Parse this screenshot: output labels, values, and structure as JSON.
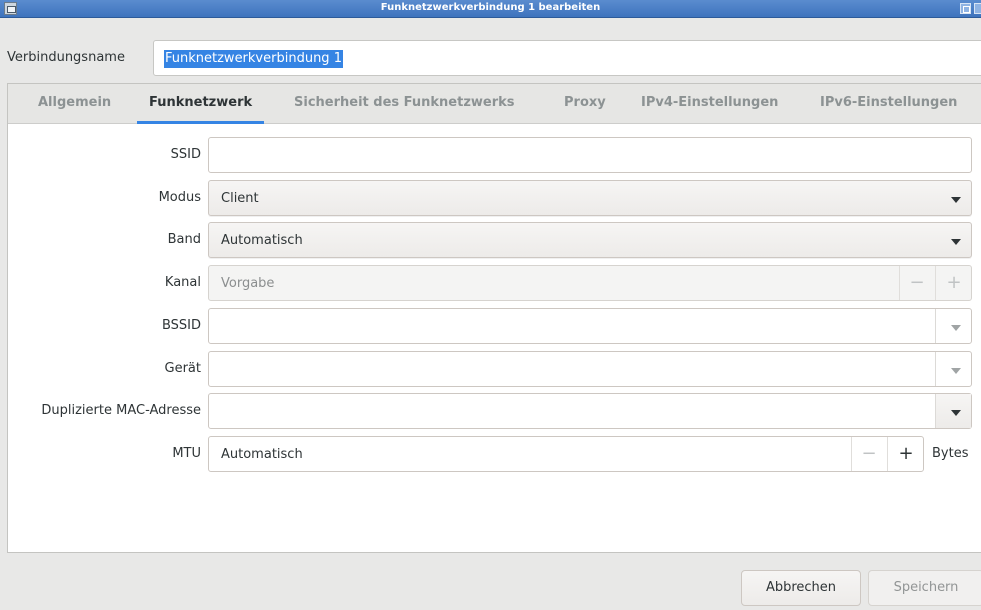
{
  "window": {
    "title": "Funknetzwerkverbindung 1 bearbeiten"
  },
  "connection": {
    "label": "Verbindungsname",
    "value": "Funknetzwerkverbindung 1"
  },
  "tabs": [
    {
      "label": "Allgemein",
      "active": false
    },
    {
      "label": "Funknetzwerk",
      "active": true
    },
    {
      "label": "Sicherheit des Funknetzwerks",
      "active": false
    },
    {
      "label": "Proxy",
      "active": false
    },
    {
      "label": "IPv4-Einstellungen",
      "active": false
    },
    {
      "label": "IPv6-Einstellungen",
      "active": false
    }
  ],
  "form": {
    "ssid": {
      "label": "SSID",
      "value": ""
    },
    "modus": {
      "label": "Modus",
      "value": "Client"
    },
    "band": {
      "label": "Band",
      "value": "Automatisch"
    },
    "kanal": {
      "label": "Kanal",
      "placeholder": "Vorgabe",
      "minus": "−",
      "plus": "+"
    },
    "bssid": {
      "label": "BSSID",
      "value": ""
    },
    "geraet": {
      "label": "Gerät",
      "value": ""
    },
    "mac": {
      "label": "Duplizierte MAC-Adresse",
      "value": ""
    },
    "mtu": {
      "label": "MTU",
      "value": "Automatisch",
      "minus": "−",
      "plus": "+",
      "unit": "Bytes"
    }
  },
  "buttons": {
    "cancel": "Abbrechen",
    "save": "Speichern"
  },
  "colors": {
    "accent": "#3584e4",
    "titlebar": "#3e73bd"
  }
}
